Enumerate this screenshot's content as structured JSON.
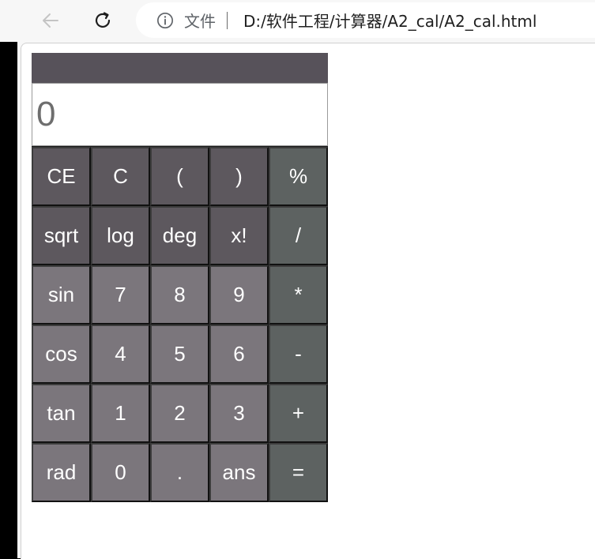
{
  "browser": {
    "scheme_label": "文件",
    "url": "D:/软件工程/计算器/A2_cal/A2_cal.html",
    "icons": {
      "back": "arrow-left-icon",
      "reload": "reload-icon",
      "info": "info-circle-icon"
    }
  },
  "calculator": {
    "display_value": "0",
    "colors": {
      "header": "#57525a",
      "function_key": "#5d585e",
      "number_key": "#7b767c",
      "operator_key": "#5d6261",
      "display_text": "#6e6e6e"
    },
    "keys": [
      {
        "label": "CE",
        "kind": "fn",
        "name": "clear-entry-button"
      },
      {
        "label": "C",
        "kind": "fn",
        "name": "clear-button"
      },
      {
        "label": "(",
        "kind": "fn",
        "name": "open-paren-button"
      },
      {
        "label": ")",
        "kind": "fn",
        "name": "close-paren-button"
      },
      {
        "label": "%",
        "kind": "op",
        "name": "percent-button"
      },
      {
        "label": "sqrt",
        "kind": "fn",
        "name": "sqrt-button"
      },
      {
        "label": "log",
        "kind": "fn",
        "name": "log-button"
      },
      {
        "label": "deg",
        "kind": "fn",
        "name": "deg-button"
      },
      {
        "label": "x!",
        "kind": "fn",
        "name": "factorial-button"
      },
      {
        "label": "/",
        "kind": "op",
        "name": "divide-button"
      },
      {
        "label": "sin",
        "kind": "num",
        "name": "sin-button"
      },
      {
        "label": "7",
        "kind": "num",
        "name": "digit-7-button"
      },
      {
        "label": "8",
        "kind": "num",
        "name": "digit-8-button"
      },
      {
        "label": "9",
        "kind": "num",
        "name": "digit-9-button"
      },
      {
        "label": "*",
        "kind": "op",
        "name": "multiply-button"
      },
      {
        "label": "cos",
        "kind": "num",
        "name": "cos-button"
      },
      {
        "label": "4",
        "kind": "num",
        "name": "digit-4-button"
      },
      {
        "label": "5",
        "kind": "num",
        "name": "digit-5-button"
      },
      {
        "label": "6",
        "kind": "num",
        "name": "digit-6-button"
      },
      {
        "label": "-",
        "kind": "op",
        "name": "subtract-button"
      },
      {
        "label": "tan",
        "kind": "num",
        "name": "tan-button"
      },
      {
        "label": "1",
        "kind": "num",
        "name": "digit-1-button"
      },
      {
        "label": "2",
        "kind": "num",
        "name": "digit-2-button"
      },
      {
        "label": "3",
        "kind": "num",
        "name": "digit-3-button"
      },
      {
        "label": "+",
        "kind": "op",
        "name": "add-button"
      },
      {
        "label": "rad",
        "kind": "num",
        "name": "rad-button"
      },
      {
        "label": "0",
        "kind": "num",
        "name": "digit-0-button"
      },
      {
        "label": ".",
        "kind": "num",
        "name": "decimal-button"
      },
      {
        "label": "ans",
        "kind": "num",
        "name": "ans-button"
      },
      {
        "label": "=",
        "kind": "op",
        "name": "equals-button"
      }
    ]
  }
}
